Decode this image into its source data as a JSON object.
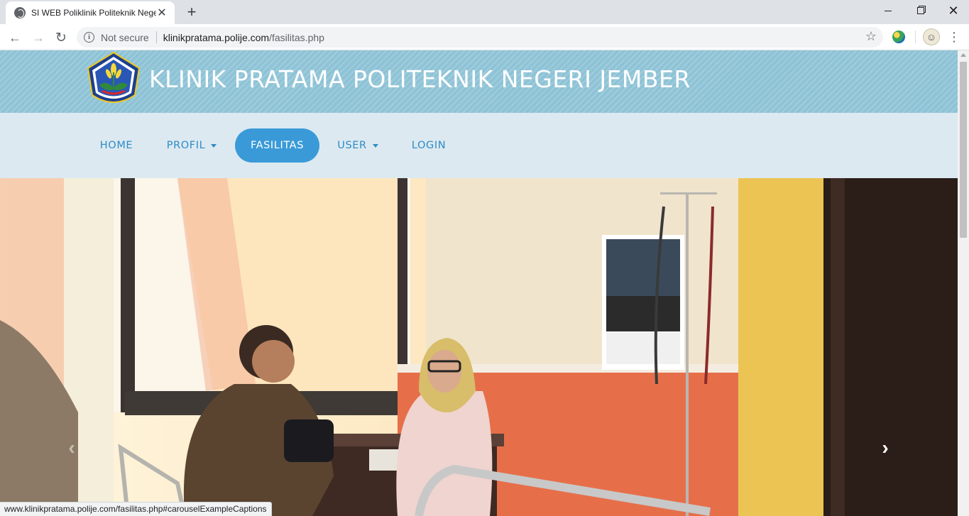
{
  "browser": {
    "tab_title": "SI WEB Poliklinik Politeknik Negeri Jember",
    "tab_close": "✕",
    "new_tab": "+",
    "security_label": "Not secure",
    "url_host": "klinikpratama.polije.com",
    "url_path": "/fasilitas.php",
    "status_url": "www.klinikpratama.polije.com/fasilitas.php#carouselExampleCaptions",
    "icons": [
      "globe-icon",
      "back-arrow-icon",
      "forward-arrow-icon",
      "reload-icon",
      "info-icon",
      "star-icon",
      "extension-icon",
      "profile-avatar-icon",
      "kebab-menu-icon"
    ]
  },
  "header": {
    "site_title": "KLINIK PRATAMA POLITEKNIK NEGERI JEMBER",
    "logo": "polije-logo"
  },
  "nav": {
    "items": [
      {
        "label": "HOME",
        "dropdown": false,
        "active": false
      },
      {
        "label": "PROFIL",
        "dropdown": true,
        "active": false
      },
      {
        "label": "FASILITAS",
        "dropdown": false,
        "active": true
      },
      {
        "label": "USER",
        "dropdown": true,
        "active": false
      },
      {
        "label": "LOGIN",
        "dropdown": false,
        "active": false
      }
    ]
  },
  "carousel": {
    "prev_glyph": "‹",
    "next_glyph": "›"
  },
  "colors": {
    "header_bg": "#8ec3d6",
    "navbar_bg": "#dce9f1",
    "nav_text": "#2f8bc4",
    "nav_active_bg": "#3a9ad8"
  }
}
